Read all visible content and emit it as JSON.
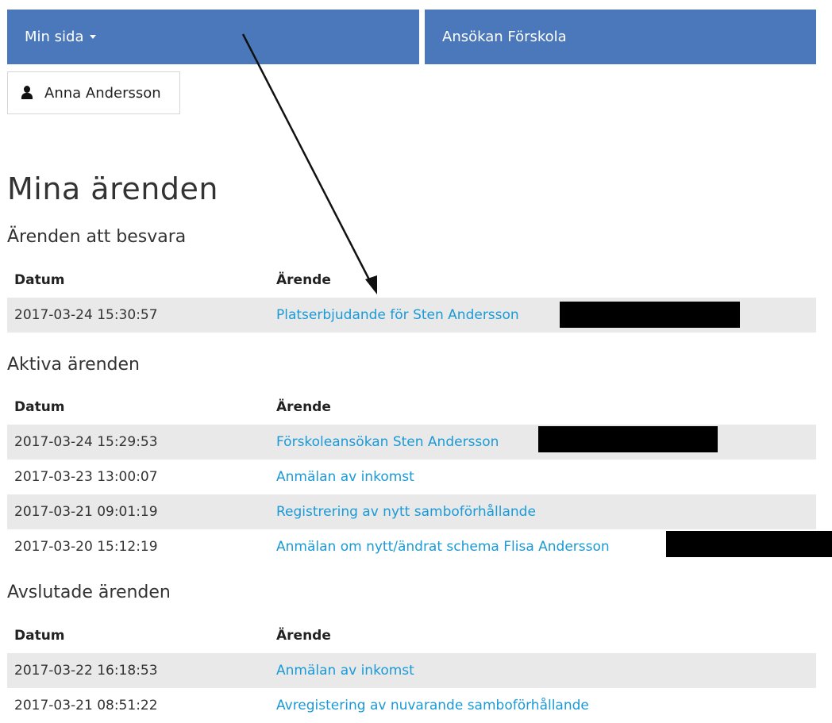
{
  "nav": {
    "left_label": "Min sida",
    "right_label": "Ansökan Förskola"
  },
  "user": {
    "name": "Anna Andersson",
    "icon": "user-icon"
  },
  "page_title": "Mina ärenden",
  "sections": {
    "respond": {
      "title": "Ärenden att besvara",
      "header": {
        "date": "Datum",
        "case": "Ärende"
      },
      "rows": [
        {
          "date": "2017-03-24 15:30:57",
          "case": "Platserbjudande för Sten Andersson"
        }
      ]
    },
    "active": {
      "title": "Aktiva ärenden",
      "header": {
        "date": "Datum",
        "case": "Ärende"
      },
      "rows": [
        {
          "date": "2017-03-24 15:29:53",
          "case": "Förskoleansökan Sten Andersson"
        },
        {
          "date": "2017-03-23 13:00:07",
          "case": "Anmälan av inkomst"
        },
        {
          "date": "2017-03-21 09:01:19",
          "case": "Registrering av nytt samboförhållande"
        },
        {
          "date": "2017-03-20 15:12:19",
          "case": "Anmälan om nytt/ändrat schema Flisa Andersson"
        }
      ]
    },
    "closed": {
      "title": "Avslutade ärenden",
      "header": {
        "date": "Datum",
        "case": "Ärende"
      },
      "rows": [
        {
          "date": "2017-03-22 16:18:53",
          "case": "Anmälan av inkomst"
        },
        {
          "date": "2017-03-21 08:51:22",
          "case": "Avregistering av nuvarande samboförhållande"
        }
      ]
    }
  },
  "colors": {
    "nav_bg": "#4a78ba",
    "link": "#1a9ad6",
    "row_alt": "#e9e9e9"
  }
}
